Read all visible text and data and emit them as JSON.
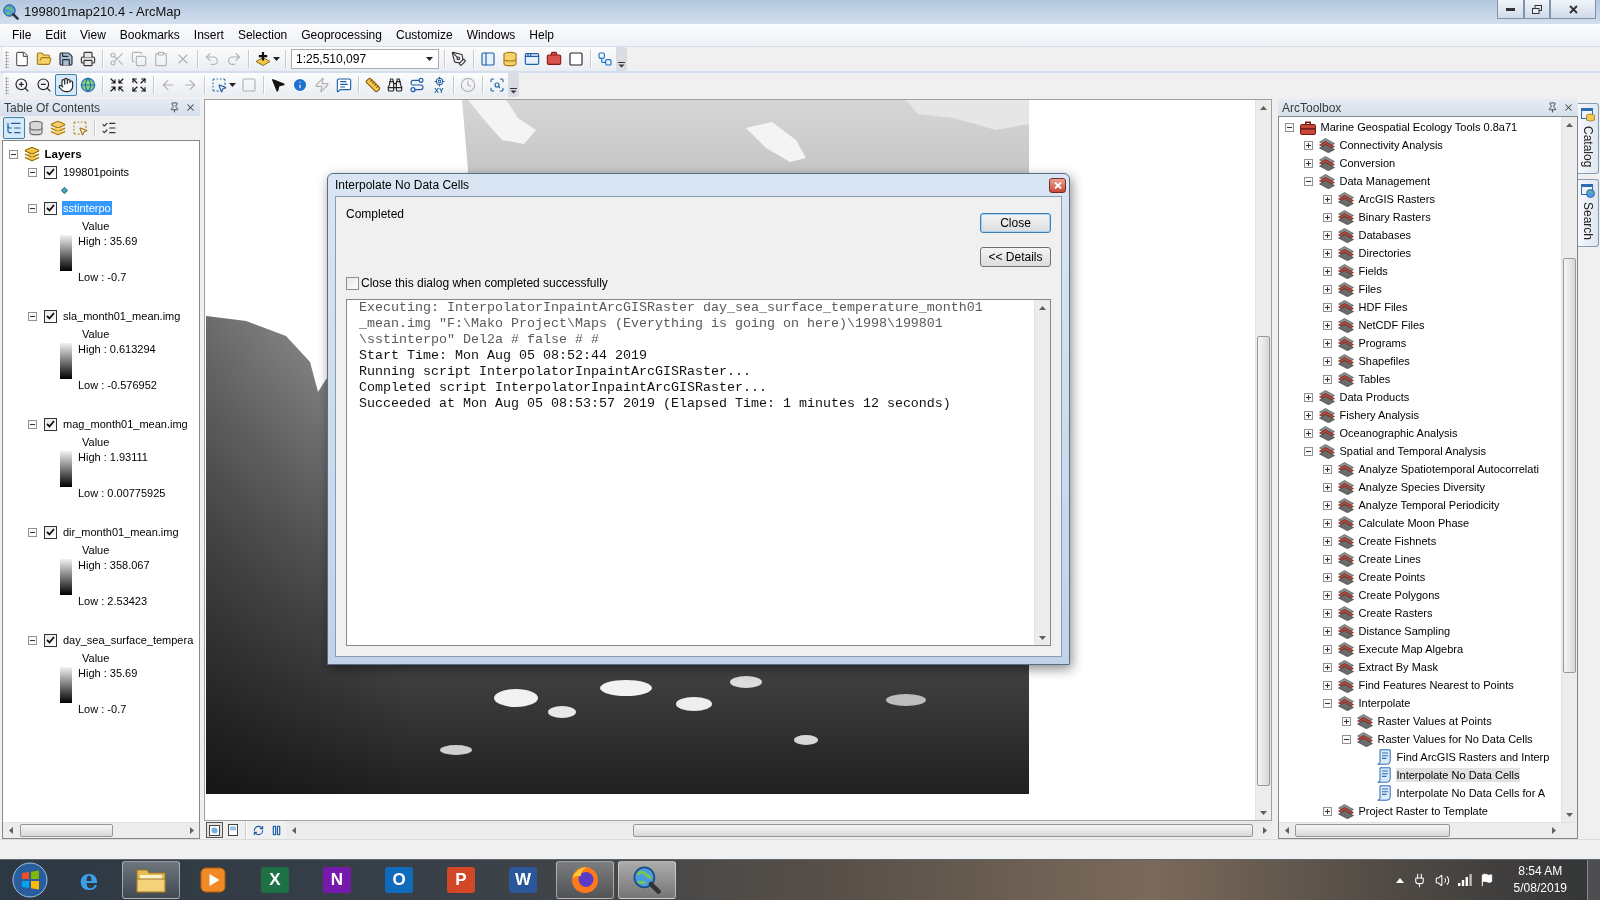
{
  "window": {
    "title": "199801map210.4 - ArcMap"
  },
  "menu": [
    "File",
    "Edit",
    "View",
    "Bookmarks",
    "Insert",
    "Selection",
    "Geoprocessing",
    "Customize",
    "Windows",
    "Help"
  ],
  "standard_toolbar": [
    {
      "kind": "new-document",
      "disabled": false
    },
    {
      "kind": "open",
      "disabled": false
    },
    {
      "kind": "save",
      "disabled": false
    },
    {
      "kind": "print",
      "disabled": false
    },
    {
      "kind": "separator"
    },
    {
      "kind": "cut",
      "disabled": true
    },
    {
      "kind": "copy",
      "disabled": true
    },
    {
      "kind": "paste",
      "disabled": true
    },
    {
      "kind": "delete",
      "disabled": true
    },
    {
      "kind": "separator"
    },
    {
      "kind": "undo",
      "disabled": true
    },
    {
      "kind": "redo",
      "disabled": true
    },
    {
      "kind": "separator"
    },
    {
      "kind": "add-data",
      "disabled": false
    },
    {
      "kind": "separator"
    },
    {
      "kind": "scale",
      "value": "1:25,510,097"
    },
    {
      "kind": "separator"
    },
    {
      "kind": "editor",
      "disabled": false
    },
    {
      "kind": "separator"
    },
    {
      "kind": "toc-window",
      "disabled": false
    },
    {
      "kind": "catalog-window",
      "disabled": false
    },
    {
      "kind": "search-window",
      "disabled": false
    },
    {
      "kind": "toolbox-window",
      "disabled": false
    },
    {
      "kind": "python-window",
      "disabled": false
    },
    {
      "kind": "separator"
    },
    {
      "kind": "model-builder",
      "disabled": false
    }
  ],
  "tools_toolbar": [
    {
      "kind": "zoom-in",
      "disabled": false,
      "selected": false
    },
    {
      "kind": "zoom-out",
      "disabled": false,
      "selected": false
    },
    {
      "kind": "pan",
      "disabled": false,
      "selected": true
    },
    {
      "kind": "full-extent",
      "disabled": false,
      "selected": false
    },
    {
      "kind": "separator"
    },
    {
      "kind": "fixed-zoom-in",
      "disabled": false,
      "selected": false
    },
    {
      "kind": "fixed-zoom-out",
      "disabled": false,
      "selected": false
    },
    {
      "kind": "separator"
    },
    {
      "kind": "back",
      "disabled": true,
      "selected": false
    },
    {
      "kind": "forward",
      "disabled": true,
      "selected": false
    },
    {
      "kind": "separator"
    },
    {
      "kind": "select-features",
      "disabled": false,
      "selected": false
    },
    {
      "kind": "clear-selection",
      "disabled": true,
      "selected": false
    },
    {
      "kind": "separator"
    },
    {
      "kind": "select-elements",
      "disabled": false,
      "selected": false
    },
    {
      "kind": "identify",
      "disabled": false,
      "selected": false
    },
    {
      "kind": "hyperlink",
      "disabled": true,
      "selected": false
    },
    {
      "kind": "html-popup",
      "disabled": false,
      "selected": false
    },
    {
      "kind": "separator"
    },
    {
      "kind": "measure",
      "disabled": false,
      "selected": false
    },
    {
      "kind": "find",
      "disabled": false,
      "selected": false
    },
    {
      "kind": "find-route",
      "disabled": false,
      "selected": false
    },
    {
      "kind": "go-to-xy",
      "label": "XY",
      "disabled": false,
      "selected": false
    },
    {
      "kind": "separator"
    },
    {
      "kind": "time-slider",
      "disabled": true,
      "selected": false
    },
    {
      "kind": "separator"
    },
    {
      "kind": "viewer",
      "disabled": false,
      "selected": false
    }
  ],
  "table_of_contents": {
    "title": "Table Of Contents",
    "view_buttons": [
      {
        "kind": "drawing-order",
        "selected": true
      },
      {
        "kind": "source",
        "selected": false
      },
      {
        "kind": "visibility",
        "selected": false
      },
      {
        "kind": "selection",
        "selected": false
      }
    ],
    "tree": [
      {
        "label": "Layers",
        "expanded": true,
        "children": [
          {
            "label": "199801points",
            "checked": true,
            "expanded": true,
            "selected": false,
            "legend": {
              "kind": "point"
            }
          },
          {
            "label": "sstinterpo",
            "checked": true,
            "expanded": true,
            "selected": true,
            "legend": {
              "kind": "stretch",
              "field": "Value",
              "high": "High : 35.69",
              "low": "Low : -0.7"
            }
          },
          {
            "label": "sla_month01_mean.img",
            "checked": true,
            "expanded": true,
            "selected": false,
            "legend": {
              "kind": "stretch",
              "field": "Value",
              "high": "High : 0.613294",
              "low": "Low : -0.576952"
            }
          },
          {
            "label": "mag_month01_mean.img",
            "checked": true,
            "expanded": true,
            "selected": false,
            "legend": {
              "kind": "stretch",
              "field": "Value",
              "high": "High : 1.93111",
              "low": "Low : 0.00775925"
            }
          },
          {
            "label": "dir_month01_mean.img",
            "checked": true,
            "expanded": true,
            "selected": false,
            "legend": {
              "kind": "stretch",
              "field": "Value",
              "high": "High : 358.067",
              "low": "Low : 2.53423"
            }
          },
          {
            "label": "day_sea_surface_tempera",
            "checked": true,
            "expanded": true,
            "selected": false,
            "legend": {
              "kind": "stretch",
              "field": "Value",
              "high": "High : 35.69",
              "low": "Low : -0.7"
            }
          }
        ]
      }
    ]
  },
  "map": {
    "view_buttons": [
      {
        "kind": "data",
        "selected": true
      },
      {
        "kind": "layout",
        "selected": false
      }
    ]
  },
  "dialog": {
    "title": "Interpolate No Data Cells",
    "status": "Completed",
    "buttons": [
      {
        "label": "Close",
        "default": true
      },
      {
        "label": "<< Details",
        "default": false
      }
    ],
    "auto_close": {
      "label": "Close this dialog when completed successfully",
      "checked": false
    },
    "log": [
      {
        "kind": "command",
        "text": "Executing: InterpolatorInpaintArcGISRaster day_sea_surface_temperature_month01"
      },
      {
        "kind": "command",
        "text": "_mean.img \"F:\\Mako Project\\Maps (Everything is going on here)\\1998\\199801"
      },
      {
        "kind": "command",
        "text": "\\sstinterpo\" Del2a # false # #"
      },
      {
        "kind": "message",
        "text": "Start Time: Mon Aug 05 08:52:44 2019"
      },
      {
        "kind": "message",
        "text": "Running script InterpolatorInpaintArcGISRaster..."
      },
      {
        "kind": "message",
        "text": "Completed script InterpolatorInpaintArcGISRaster..."
      },
      {
        "kind": "message",
        "text": "Succeeded at Mon Aug 05 08:53:57 2019 (Elapsed Time: 1 minutes 12 seconds)"
      }
    ]
  },
  "arctoolbox": {
    "title": "ArcToolbox",
    "tree": [
      {
        "kind": "toolbox",
        "label": "Marine Geospatial Ecology Tools 0.8a71",
        "expanded": true,
        "selected": false,
        "children": [
          {
            "kind": "toolset",
            "label": "Connectivity Analysis",
            "expanded": false,
            "selected": false
          },
          {
            "kind": "toolset",
            "label": "Conversion",
            "expanded": false,
            "selected": false
          },
          {
            "kind": "toolset",
            "label": "Data Management",
            "expanded": true,
            "selected": false,
            "children": [
              {
                "kind": "toolset",
                "label": "ArcGIS Rasters",
                "expanded": false,
                "selected": false
              },
              {
                "kind": "toolset",
                "label": "Binary Rasters",
                "expanded": false,
                "selected": false
              },
              {
                "kind": "toolset",
                "label": "Databases",
                "expanded": false,
                "selected": false
              },
              {
                "kind": "toolset",
                "label": "Directories",
                "expanded": false,
                "selected": false
              },
              {
                "kind": "toolset",
                "label": "Fields",
                "expanded": false,
                "selected": false
              },
              {
                "kind": "toolset",
                "label": "Files",
                "expanded": false,
                "selected": false
              },
              {
                "kind": "toolset",
                "label": "HDF Files",
                "expanded": false,
                "selected": false
              },
              {
                "kind": "toolset",
                "label": "NetCDF Files",
                "expanded": false,
                "selected": false
              },
              {
                "kind": "toolset",
                "label": "Programs",
                "expanded": false,
                "selected": false
              },
              {
                "kind": "toolset",
                "label": "Shapefiles",
                "expanded": false,
                "selected": false
              },
              {
                "kind": "toolset",
                "label": "Tables",
                "expanded": false,
                "selected": false
              }
            ]
          },
          {
            "kind": "toolset",
            "label": "Data Products",
            "expanded": false,
            "selected": false
          },
          {
            "kind": "toolset",
            "label": "Fishery Analysis",
            "expanded": false,
            "selected": false
          },
          {
            "kind": "toolset",
            "label": "Oceanographic Analysis",
            "expanded": false,
            "selected": false
          },
          {
            "kind": "toolset",
            "label": "Spatial and Temporal Analysis",
            "expanded": true,
            "selected": false,
            "children": [
              {
                "kind": "toolset",
                "label": "Analyze Spatiotemporal Autocorrelati",
                "expanded": false,
                "selected": false
              },
              {
                "kind": "toolset",
                "label": "Analyze Species Diversity",
                "expanded": false,
                "selected": false
              },
              {
                "kind": "toolset",
                "label": "Analyze Temporal Periodicity",
                "expanded": false,
                "selected": false
              },
              {
                "kind": "toolset",
                "label": "Calculate Moon Phase",
                "expanded": false,
                "selected": false
              },
              {
                "kind": "toolset",
                "label": "Create Fishnets",
                "expanded": false,
                "selected": false
              },
              {
                "kind": "toolset",
                "label": "Create Lines",
                "expanded": false,
                "selected": false
              },
              {
                "kind": "toolset",
                "label": "Create Points",
                "expanded": false,
                "selected": false
              },
              {
                "kind": "toolset",
                "label": "Create Polygons",
                "expanded": false,
                "selected": false
              },
              {
                "kind": "toolset",
                "label": "Create Rasters",
                "expanded": false,
                "selected": false
              },
              {
                "kind": "toolset",
                "label": "Distance Sampling",
                "expanded": false,
                "selected": false
              },
              {
                "kind": "toolset",
                "label": "Execute Map Algebra",
                "expanded": false,
                "selected": false
              },
              {
                "kind": "toolset",
                "label": "Extract By Mask",
                "expanded": false,
                "selected": false
              },
              {
                "kind": "toolset",
                "label": "Find Features Nearest to Points",
                "expanded": false,
                "selected": false
              },
              {
                "kind": "toolset",
                "label": "Interpolate",
                "expanded": true,
                "selected": false,
                "children": [
                  {
                    "kind": "toolset",
                    "label": "Raster Values at Points",
                    "expanded": false,
                    "selected": false
                  },
                  {
                    "kind": "toolset",
                    "label": "Raster Values for No Data Cells",
                    "expanded": true,
                    "selected": false,
                    "children": [
                      {
                        "kind": "script",
                        "label": "Find ArcGIS Rasters and Interp",
                        "selected": false
                      },
                      {
                        "kind": "script",
                        "label": "Interpolate No Data Cells",
                        "selected": true
                      },
                      {
                        "kind": "script",
                        "label": "Interpolate No Data Cells for A",
                        "selected": false
                      }
                    ]
                  }
                ]
              },
              {
                "kind": "toolset",
                "label": "Project Raster to Template",
                "expanded": false,
                "selected": false
              }
            ]
          }
        ]
      }
    ]
  },
  "side_tabs": [
    {
      "kind": "catalog",
      "label": "Catalog",
      "selected": false
    },
    {
      "kind": "search",
      "label": "Search",
      "selected": false
    }
  ],
  "taskbar": {
    "apps": [
      {
        "kind": "ie",
        "letter": "e",
        "running": false,
        "selected": false
      },
      {
        "kind": "explorer",
        "running": true,
        "selected": false
      },
      {
        "kind": "media",
        "running": false,
        "selected": false
      },
      {
        "kind": "excel",
        "letter": "X",
        "running": false,
        "selected": false
      },
      {
        "kind": "onenote",
        "letter": "N",
        "running": false,
        "selected": false
      },
      {
        "kind": "outlook",
        "letter": "O",
        "running": false,
        "selected": false
      },
      {
        "kind": "powerpoint",
        "letter": "P",
        "running": false,
        "selected": false
      },
      {
        "kind": "word",
        "letter": "W",
        "running": false,
        "selected": false
      },
      {
        "kind": "firefox",
        "running": true,
        "selected": false
      },
      {
        "kind": "arcmap",
        "running": true,
        "selected": true
      }
    ],
    "clock": {
      "time": "8:54 AM",
      "date": "5/08/2019"
    }
  }
}
